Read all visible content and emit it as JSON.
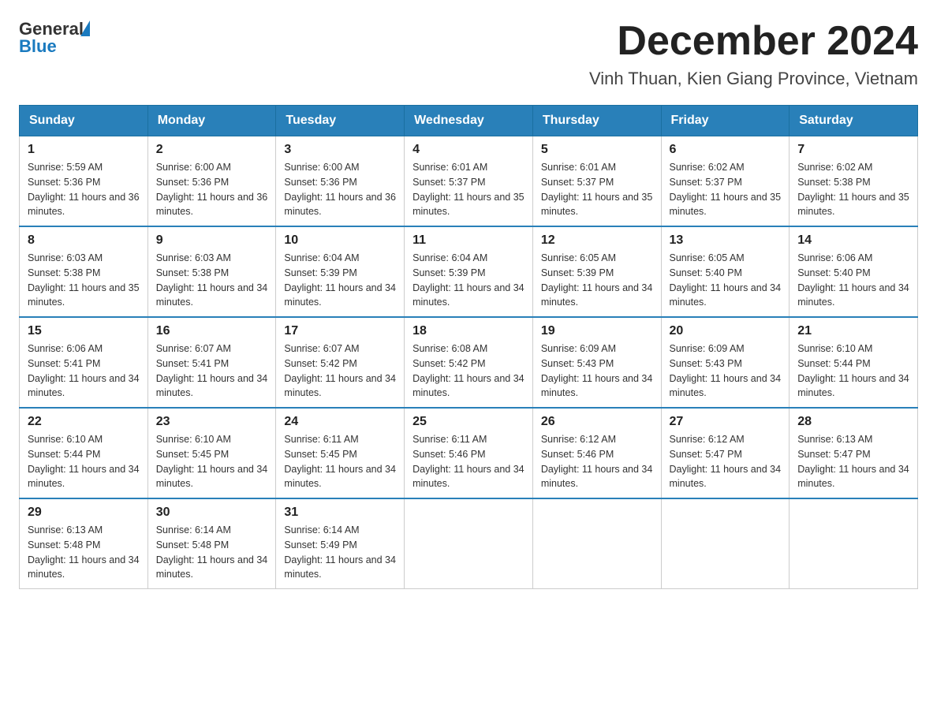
{
  "header": {
    "logo": {
      "general": "General",
      "blue": "Blue",
      "arrow_unicode": "▶"
    },
    "title": "December 2024",
    "subtitle": "Vinh Thuan, Kien Giang Province, Vietnam"
  },
  "days_of_week": [
    "Sunday",
    "Monday",
    "Tuesday",
    "Wednesday",
    "Thursday",
    "Friday",
    "Saturday"
  ],
  "weeks": [
    [
      {
        "day": "1",
        "sunrise": "Sunrise: 5:59 AM",
        "sunset": "Sunset: 5:36 PM",
        "daylight": "Daylight: 11 hours and 36 minutes."
      },
      {
        "day": "2",
        "sunrise": "Sunrise: 6:00 AM",
        "sunset": "Sunset: 5:36 PM",
        "daylight": "Daylight: 11 hours and 36 minutes."
      },
      {
        "day": "3",
        "sunrise": "Sunrise: 6:00 AM",
        "sunset": "Sunset: 5:36 PM",
        "daylight": "Daylight: 11 hours and 36 minutes."
      },
      {
        "day": "4",
        "sunrise": "Sunrise: 6:01 AM",
        "sunset": "Sunset: 5:37 PM",
        "daylight": "Daylight: 11 hours and 35 minutes."
      },
      {
        "day": "5",
        "sunrise": "Sunrise: 6:01 AM",
        "sunset": "Sunset: 5:37 PM",
        "daylight": "Daylight: 11 hours and 35 minutes."
      },
      {
        "day": "6",
        "sunrise": "Sunrise: 6:02 AM",
        "sunset": "Sunset: 5:37 PM",
        "daylight": "Daylight: 11 hours and 35 minutes."
      },
      {
        "day": "7",
        "sunrise": "Sunrise: 6:02 AM",
        "sunset": "Sunset: 5:38 PM",
        "daylight": "Daylight: 11 hours and 35 minutes."
      }
    ],
    [
      {
        "day": "8",
        "sunrise": "Sunrise: 6:03 AM",
        "sunset": "Sunset: 5:38 PM",
        "daylight": "Daylight: 11 hours and 35 minutes."
      },
      {
        "day": "9",
        "sunrise": "Sunrise: 6:03 AM",
        "sunset": "Sunset: 5:38 PM",
        "daylight": "Daylight: 11 hours and 34 minutes."
      },
      {
        "day": "10",
        "sunrise": "Sunrise: 6:04 AM",
        "sunset": "Sunset: 5:39 PM",
        "daylight": "Daylight: 11 hours and 34 minutes."
      },
      {
        "day": "11",
        "sunrise": "Sunrise: 6:04 AM",
        "sunset": "Sunset: 5:39 PM",
        "daylight": "Daylight: 11 hours and 34 minutes."
      },
      {
        "day": "12",
        "sunrise": "Sunrise: 6:05 AM",
        "sunset": "Sunset: 5:39 PM",
        "daylight": "Daylight: 11 hours and 34 minutes."
      },
      {
        "day": "13",
        "sunrise": "Sunrise: 6:05 AM",
        "sunset": "Sunset: 5:40 PM",
        "daylight": "Daylight: 11 hours and 34 minutes."
      },
      {
        "day": "14",
        "sunrise": "Sunrise: 6:06 AM",
        "sunset": "Sunset: 5:40 PM",
        "daylight": "Daylight: 11 hours and 34 minutes."
      }
    ],
    [
      {
        "day": "15",
        "sunrise": "Sunrise: 6:06 AM",
        "sunset": "Sunset: 5:41 PM",
        "daylight": "Daylight: 11 hours and 34 minutes."
      },
      {
        "day": "16",
        "sunrise": "Sunrise: 6:07 AM",
        "sunset": "Sunset: 5:41 PM",
        "daylight": "Daylight: 11 hours and 34 minutes."
      },
      {
        "day": "17",
        "sunrise": "Sunrise: 6:07 AM",
        "sunset": "Sunset: 5:42 PM",
        "daylight": "Daylight: 11 hours and 34 minutes."
      },
      {
        "day": "18",
        "sunrise": "Sunrise: 6:08 AM",
        "sunset": "Sunset: 5:42 PM",
        "daylight": "Daylight: 11 hours and 34 minutes."
      },
      {
        "day": "19",
        "sunrise": "Sunrise: 6:09 AM",
        "sunset": "Sunset: 5:43 PM",
        "daylight": "Daylight: 11 hours and 34 minutes."
      },
      {
        "day": "20",
        "sunrise": "Sunrise: 6:09 AM",
        "sunset": "Sunset: 5:43 PM",
        "daylight": "Daylight: 11 hours and 34 minutes."
      },
      {
        "day": "21",
        "sunrise": "Sunrise: 6:10 AM",
        "sunset": "Sunset: 5:44 PM",
        "daylight": "Daylight: 11 hours and 34 minutes."
      }
    ],
    [
      {
        "day": "22",
        "sunrise": "Sunrise: 6:10 AM",
        "sunset": "Sunset: 5:44 PM",
        "daylight": "Daylight: 11 hours and 34 minutes."
      },
      {
        "day": "23",
        "sunrise": "Sunrise: 6:10 AM",
        "sunset": "Sunset: 5:45 PM",
        "daylight": "Daylight: 11 hours and 34 minutes."
      },
      {
        "day": "24",
        "sunrise": "Sunrise: 6:11 AM",
        "sunset": "Sunset: 5:45 PM",
        "daylight": "Daylight: 11 hours and 34 minutes."
      },
      {
        "day": "25",
        "sunrise": "Sunrise: 6:11 AM",
        "sunset": "Sunset: 5:46 PM",
        "daylight": "Daylight: 11 hours and 34 minutes."
      },
      {
        "day": "26",
        "sunrise": "Sunrise: 6:12 AM",
        "sunset": "Sunset: 5:46 PM",
        "daylight": "Daylight: 11 hours and 34 minutes."
      },
      {
        "day": "27",
        "sunrise": "Sunrise: 6:12 AM",
        "sunset": "Sunset: 5:47 PM",
        "daylight": "Daylight: 11 hours and 34 minutes."
      },
      {
        "day": "28",
        "sunrise": "Sunrise: 6:13 AM",
        "sunset": "Sunset: 5:47 PM",
        "daylight": "Daylight: 11 hours and 34 minutes."
      }
    ],
    [
      {
        "day": "29",
        "sunrise": "Sunrise: 6:13 AM",
        "sunset": "Sunset: 5:48 PM",
        "daylight": "Daylight: 11 hours and 34 minutes."
      },
      {
        "day": "30",
        "sunrise": "Sunrise: 6:14 AM",
        "sunset": "Sunset: 5:48 PM",
        "daylight": "Daylight: 11 hours and 34 minutes."
      },
      {
        "day": "31",
        "sunrise": "Sunrise: 6:14 AM",
        "sunset": "Sunset: 5:49 PM",
        "daylight": "Daylight: 11 hours and 34 minutes."
      },
      null,
      null,
      null,
      null
    ]
  ]
}
